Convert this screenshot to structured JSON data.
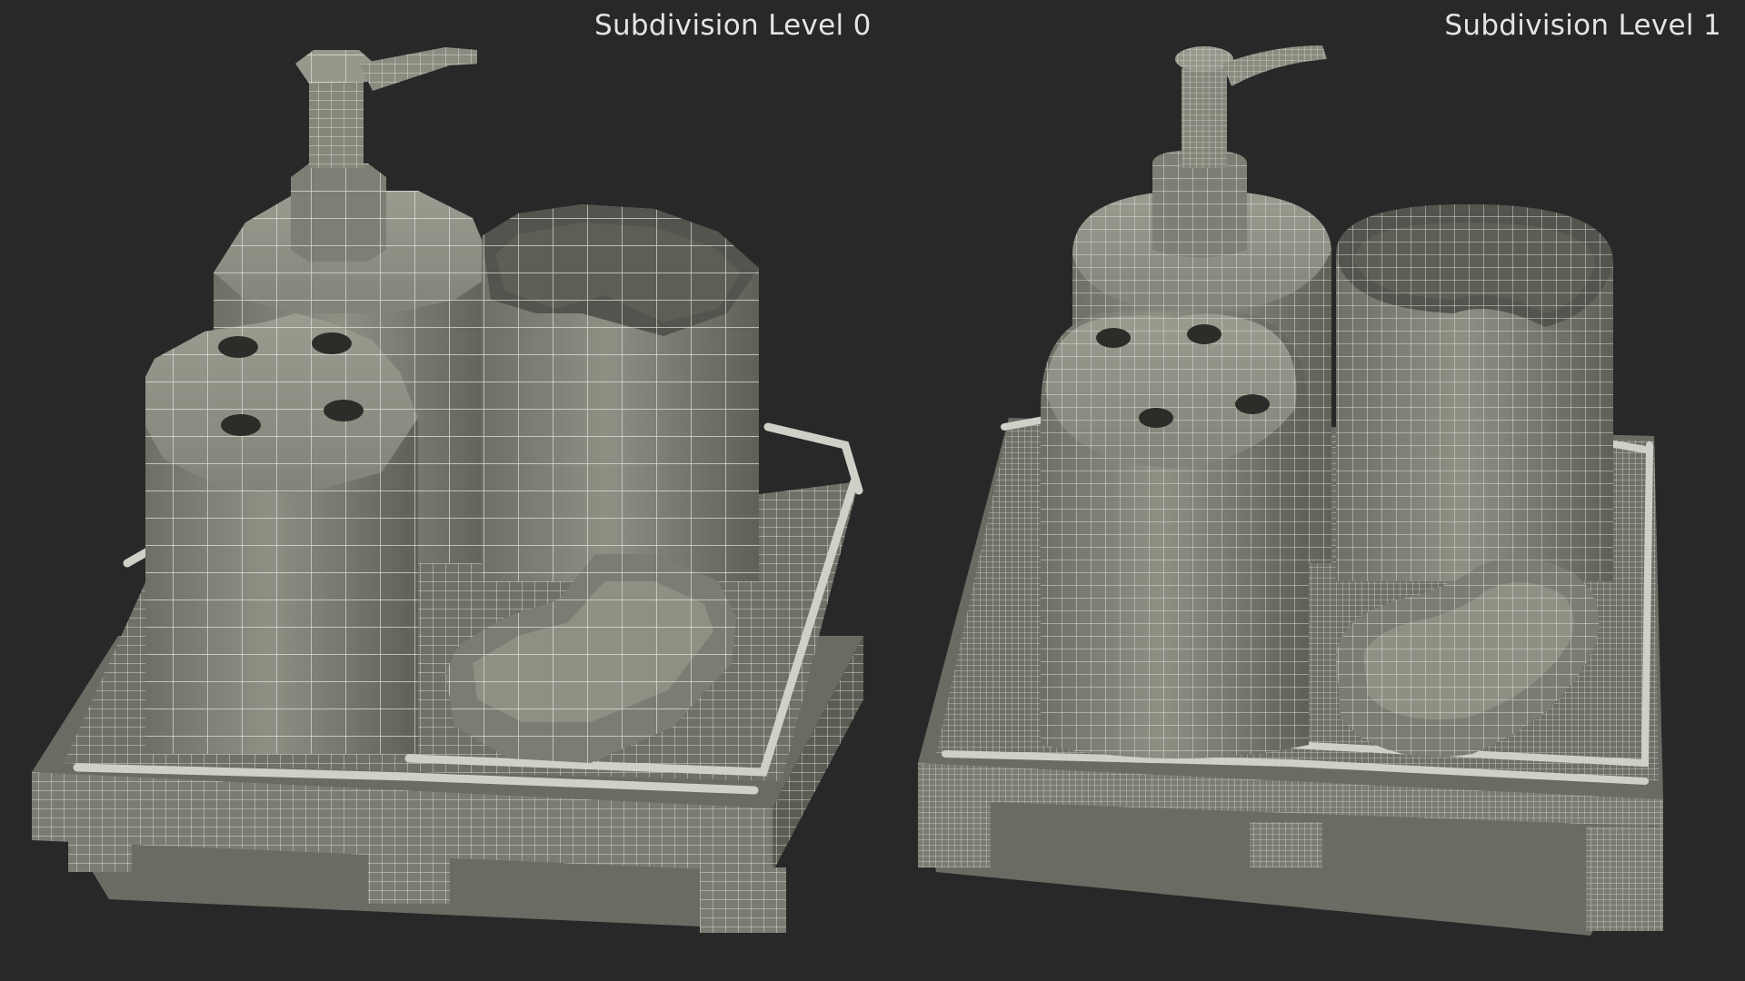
{
  "panels": {
    "left": {
      "label": "Subdivision Level 0",
      "wire_density": "low"
    },
    "right": {
      "label": "Subdivision Level 1",
      "wire_density": "high"
    }
  },
  "colors": {
    "background": "#282828",
    "surface": "#85877b",
    "surface_light": "#9a9c90",
    "surface_dark": "#60625a",
    "wire": "#e8e8e0"
  }
}
